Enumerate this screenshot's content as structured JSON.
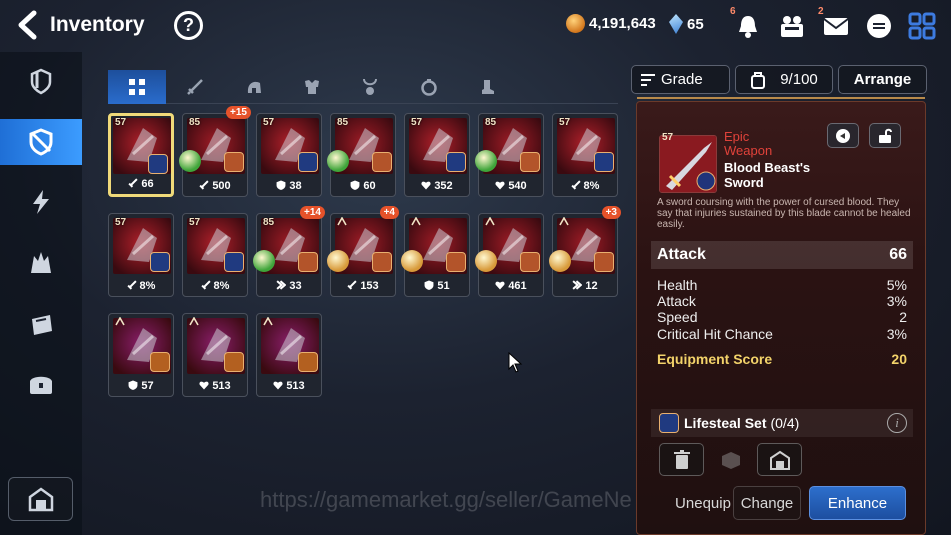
{
  "header": {
    "title": "Inventory",
    "help_label": "?",
    "gold": "4,191,643",
    "crystals": "65",
    "notif_count": "6",
    "mail_count": "2"
  },
  "tabs": [
    "all",
    "weapon",
    "helmet",
    "armor",
    "necklace",
    "ring",
    "boots"
  ],
  "toolbar": {
    "grade_label": "Grade",
    "capacity": "9/100",
    "arrange_label": "Arrange"
  },
  "items": [
    {
      "level": "57",
      "plus": "",
      "stat": "66",
      "stat_icon": "attack",
      "color": "#b0202a",
      "set": "lifesteal",
      "selected": true
    },
    {
      "level": "85",
      "plus": "+15",
      "stat": "500",
      "stat_icon": "attack",
      "color": "#a01c26",
      "set": "hit"
    },
    {
      "level": "57",
      "plus": "",
      "stat": "38",
      "stat_icon": "defense",
      "color": "#b0202a",
      "set": "lifesteal"
    },
    {
      "level": "85",
      "plus": "",
      "stat": "60",
      "stat_icon": "defense",
      "color": "#a01c26",
      "set": "hit"
    },
    {
      "level": "57",
      "plus": "",
      "stat": "352",
      "stat_icon": "health",
      "color": "#b0202a",
      "set": "lifesteal"
    },
    {
      "level": "85",
      "plus": "",
      "stat": "540",
      "stat_icon": "health",
      "color": "#a01c26",
      "set": "hit"
    },
    {
      "level": "57",
      "plus": "",
      "stat": "8%",
      "stat_icon": "attack",
      "color": "#b0202a",
      "set": "lifesteal"
    },
    {
      "level": "57",
      "plus": "",
      "stat": "8%",
      "stat_icon": "attack",
      "color": "#b0202a",
      "set": "lifesteal"
    },
    {
      "level": "57",
      "plus": "",
      "stat": "8%",
      "stat_icon": "attack",
      "color": "#b0202a",
      "set": "lifesteal"
    },
    {
      "level": "85",
      "plus": "+14",
      "stat": "33",
      "stat_icon": "speed",
      "color": "#a01c26",
      "set": "hit"
    },
    {
      "level": "",
      "plus": "+4",
      "stat": "153",
      "stat_icon": "attack",
      "color": "#a01c26",
      "set": "counter"
    },
    {
      "level": "",
      "plus": "",
      "stat": "51",
      "stat_icon": "defense",
      "color": "#a01c26",
      "set": "counter"
    },
    {
      "level": "",
      "plus": "",
      "stat": "461",
      "stat_icon": "health",
      "color": "#a01c26",
      "set": "counter"
    },
    {
      "level": "",
      "plus": "+3",
      "stat": "12",
      "stat_icon": "speed",
      "color": "#a01c26",
      "set": "counter"
    },
    {
      "level": "",
      "plus": "",
      "stat": "57",
      "stat_icon": "defense",
      "color": "#8a1e6a",
      "set": "speed"
    },
    {
      "level": "",
      "plus": "",
      "stat": "513",
      "stat_icon": "health",
      "color": "#8a1e6a",
      "set": "speed"
    },
    {
      "level": "",
      "plus": "",
      "stat": "513",
      "stat_icon": "health",
      "color": "#8a1e6a",
      "set": "speed"
    }
  ],
  "detail": {
    "level": "57",
    "rarity": "Epic",
    "type": "Weapon",
    "name_line1": "Blood Beast's",
    "name_line2": "Sword",
    "description": "A sword coursing with the power of cursed blood. They say that injuries sustained by this blade cannot be healed easily.",
    "main_stat_label": "Attack",
    "main_stat_value": "66",
    "substats": [
      {
        "label": "Health",
        "value": "5%"
      },
      {
        "label": "Attack",
        "value": "3%"
      },
      {
        "label": "Speed",
        "value": "2"
      },
      {
        "label": "Critical Hit Chance",
        "value": "3%"
      }
    ],
    "score_label": "Equipment Score",
    "score_value": "20",
    "set_label": "Lifesteal Set",
    "set_progress": "(0/4)",
    "unequip_label": "Unequip",
    "change_label": "Change",
    "enhance_label": "Enhance"
  },
  "watermark": "https://gamemarket.gg/seller/GameNe",
  "colors": {
    "accent_blue": "#2d6fcc",
    "epic_red": "#e0423a",
    "score_gold": "#f3d36a",
    "enhance_badge": "#e6522a"
  }
}
